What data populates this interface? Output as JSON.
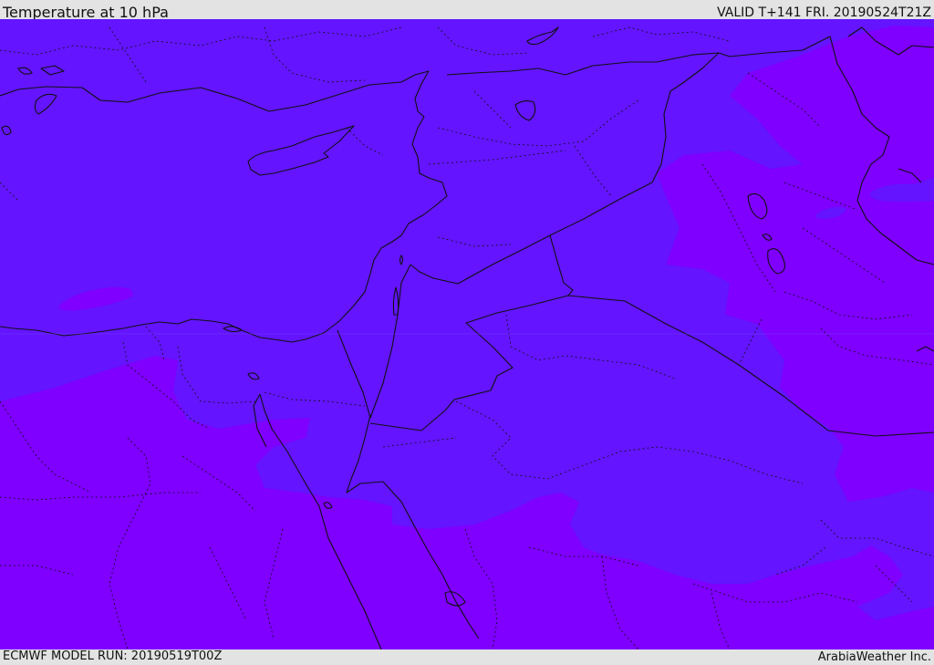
{
  "header": {
    "title": "Temperature at 10 hPa",
    "valid": "VALID T+141 FRI. 20190524T21Z"
  },
  "footer": {
    "model_run": "ECMWF MODEL RUN: 20190519T00Z",
    "credit": "ArabiaWeather Inc."
  },
  "colors": {
    "field_cool": "#6414ff",
    "field_warm": "#7f00ff",
    "border": "#111111",
    "frame": "#e3e3e3"
  }
}
